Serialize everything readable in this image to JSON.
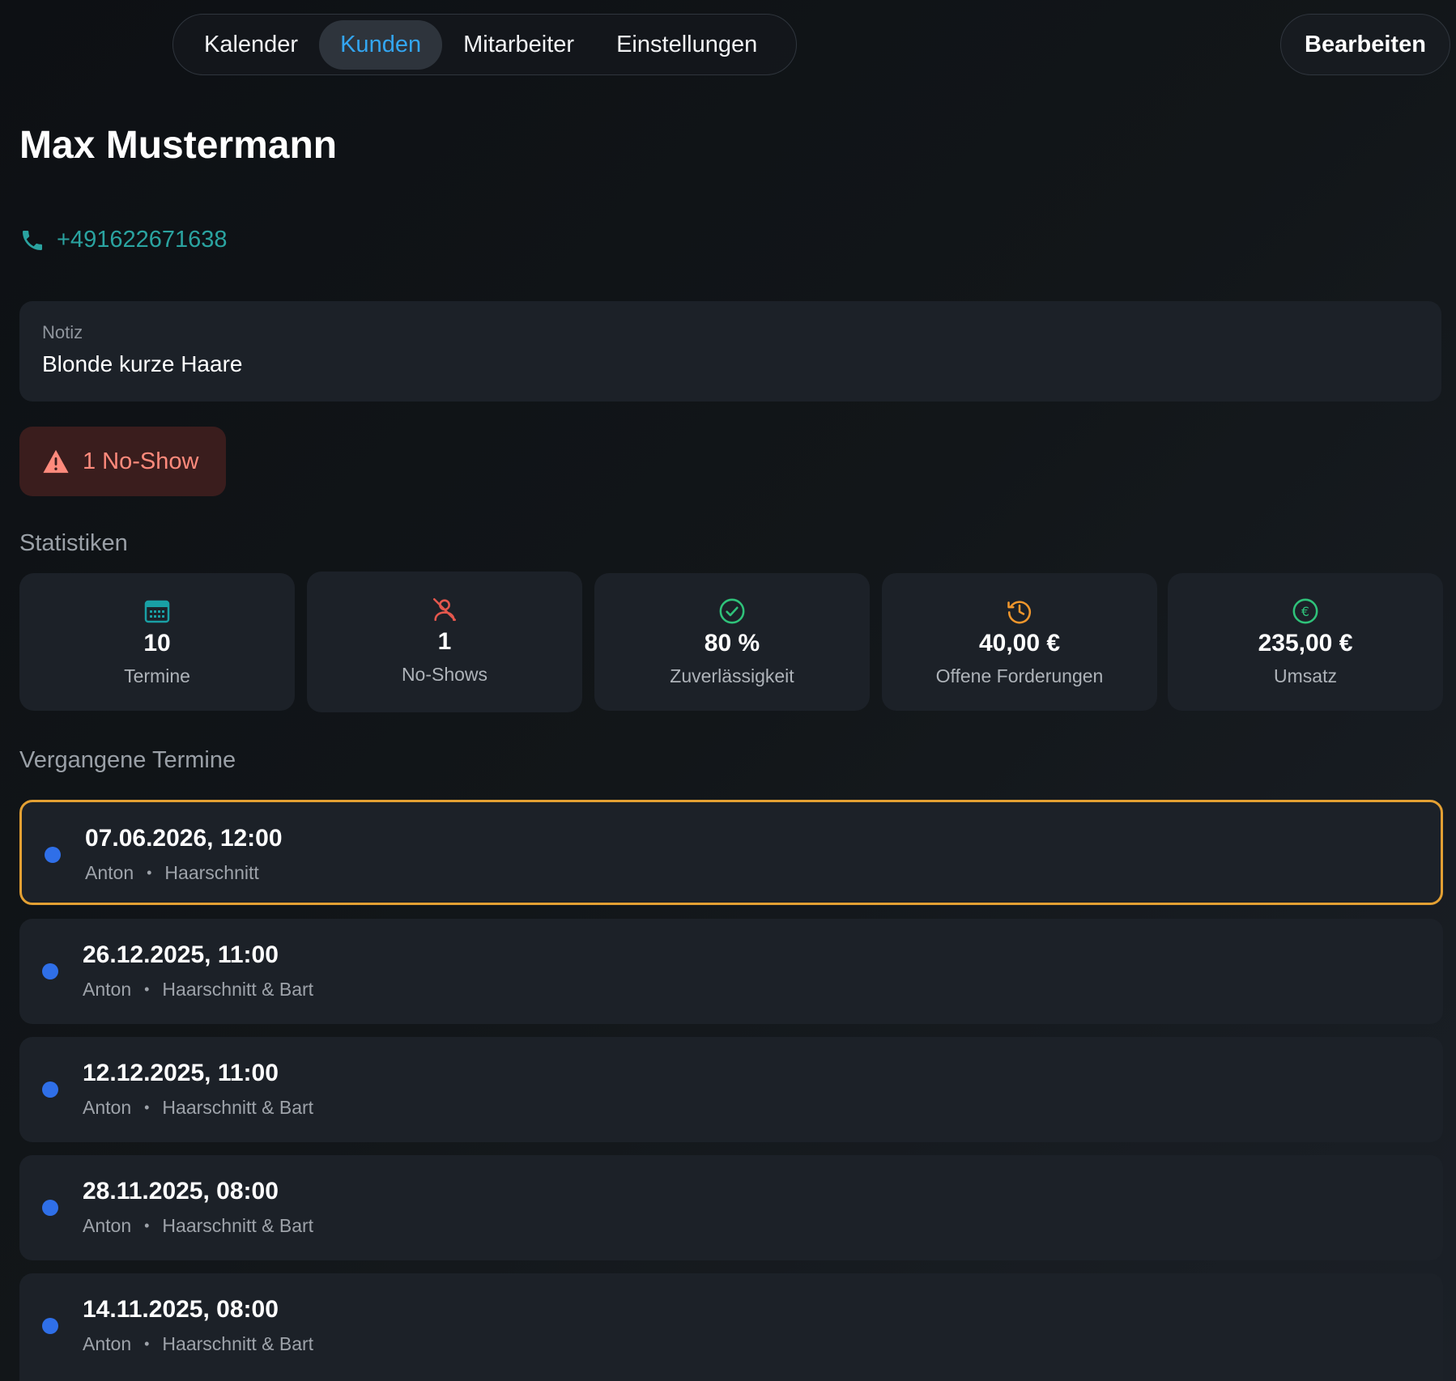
{
  "nav": {
    "tabs": [
      {
        "label": "Kalender",
        "active": false
      },
      {
        "label": "Kunden",
        "active": true
      },
      {
        "label": "Mitarbeiter",
        "active": false
      },
      {
        "label": "Einstellungen",
        "active": false
      }
    ],
    "edit_label": "Bearbeiten"
  },
  "customer": {
    "name": "Max Mustermann",
    "phone": "+491622671638"
  },
  "note": {
    "label": "Notiz",
    "text": "Blonde kurze Haare"
  },
  "noshow_badge": {
    "text": "1 No-Show"
  },
  "stats": {
    "title": "Statistiken",
    "cards": [
      {
        "icon": "calendar-icon",
        "value": "10",
        "label": "Termine",
        "color": "#19a0a5"
      },
      {
        "icon": "no-person-icon",
        "value": "1",
        "label": "No-Shows",
        "color": "#e4574d"
      },
      {
        "icon": "check-circle-icon",
        "value": "80 %",
        "label": "Zuverlässigkeit",
        "color": "#2fc27a"
      },
      {
        "icon": "history-clock-icon",
        "value": "40,00 €",
        "label": "Offene Forderungen",
        "color": "#f0962c"
      },
      {
        "icon": "euro-circle-icon",
        "value": "235,00 €",
        "label": "Umsatz",
        "color": "#2fc27a"
      }
    ]
  },
  "appointments": {
    "title": "Vergangene Termine",
    "items": [
      {
        "date": "07.06.2026, 12:00",
        "staff": "Anton",
        "separator": "•",
        "service": "Haarschnitt",
        "highlighted": true
      },
      {
        "date": "26.12.2025, 11:00",
        "staff": "Anton",
        "separator": "•",
        "service": "Haarschnitt & Bart",
        "highlighted": false
      },
      {
        "date": "12.12.2025, 11:00",
        "staff": "Anton",
        "separator": "•",
        "service": "Haarschnitt & Bart",
        "highlighted": false
      },
      {
        "date": "28.11.2025, 08:00",
        "staff": "Anton",
        "separator": "•",
        "service": "Haarschnitt & Bart",
        "highlighted": false
      },
      {
        "date": "14.11.2025, 08:00",
        "staff": "Anton",
        "separator": "•",
        "service": "Haarschnitt & Bart",
        "highlighted": false
      }
    ]
  },
  "colors": {
    "accent_tab": "#33a6f2",
    "phone": "#2aa3a0",
    "noshow_text": "#ff8a7c",
    "noshow_bg": "#3a1d1d",
    "highlight_border": "#e3a033",
    "status_dot": "#2f6fe8"
  }
}
